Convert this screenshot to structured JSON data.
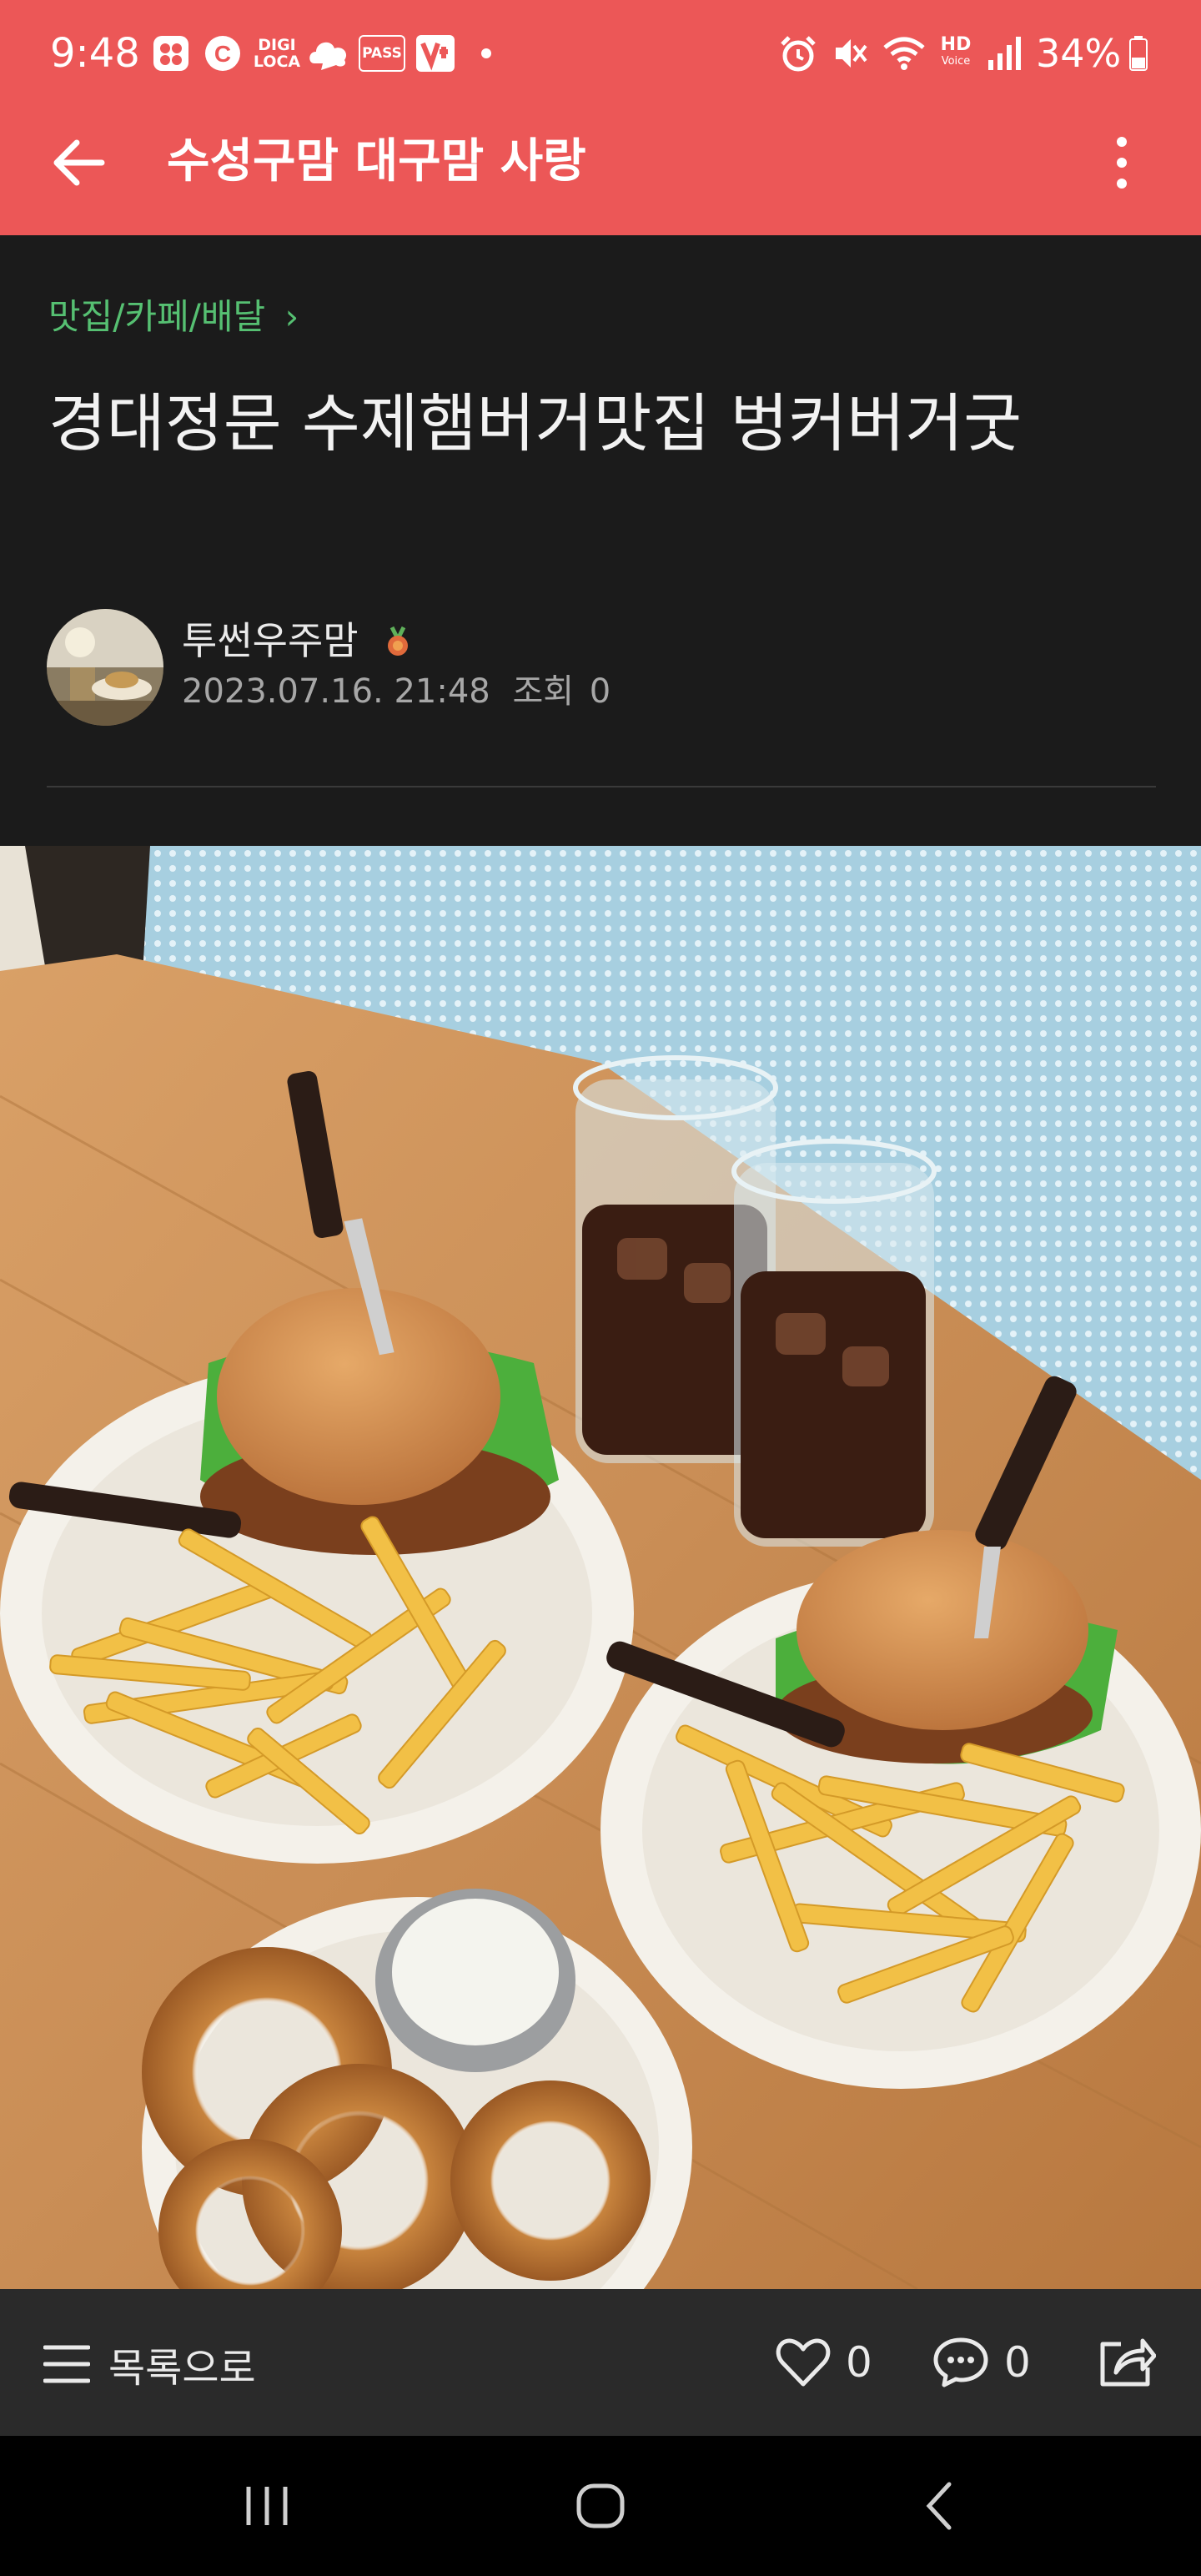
{
  "status_bar": {
    "time": "9:48",
    "battery": "34%",
    "icons": [
      "baemin-icon",
      "c-icon",
      "digilocal-icon",
      "cloud-chat-icon",
      "pass-icon",
      "v-icon",
      "dot-icon",
      "alarm-icon",
      "mute-icon",
      "wifi-icon",
      "hd-voice-icon",
      "signal-icon",
      "battery-icon"
    ],
    "labels": {
      "digi1": "DIGI",
      "digi2": "LOCA",
      "pass": "PASS",
      "hd": "HD",
      "voice": "Voice"
    }
  },
  "app_bar": {
    "title": "수성구맘 대구맘 사랑",
    "background": "#ec5757"
  },
  "post": {
    "category": "맛집/카페/배달",
    "category_chevron": "›",
    "title": "경대정문 수제햄버거맛집 벙커버거굿",
    "author": "투썬우주맘",
    "date": "2023.07.16. 21:48",
    "views_label": "조회",
    "views": "0",
    "photo_description_icon": "burger-meal-photo"
  },
  "bottom_bar": {
    "list_label": "목록으로",
    "likes": "0",
    "comments": "0"
  },
  "colors": {
    "accent": "#ec5757",
    "category_green": "#56c072",
    "background": "#1b1b1b"
  }
}
